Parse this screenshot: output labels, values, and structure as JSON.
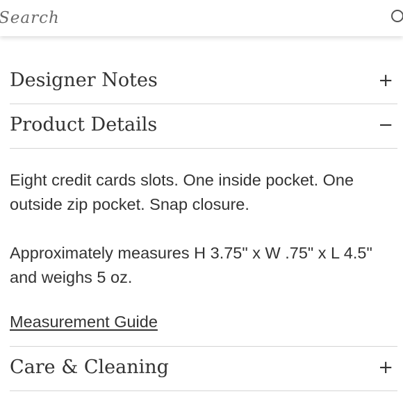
{
  "search": {
    "placeholder": "Search",
    "icon": "search-icon"
  },
  "accordion": {
    "sections": [
      {
        "title": "Designer Notes",
        "toggle": "+",
        "expanded": false
      },
      {
        "title": "Product Details",
        "toggle": "−",
        "expanded": true,
        "paragraphs": [
          "Eight credit cards slots. One inside pocket. One outside zip pocket. Snap closure.",
          "Approximately measures H 3.75\" x W .75\" x L 4.5\" and weighs 5 oz."
        ],
        "link": "Measurement Guide"
      },
      {
        "title": "Care & Cleaning",
        "toggle": "+",
        "expanded": false
      }
    ]
  },
  "colors": {
    "text": "#333333",
    "divider": "#d4d4d4",
    "background": "#ffffff"
  }
}
